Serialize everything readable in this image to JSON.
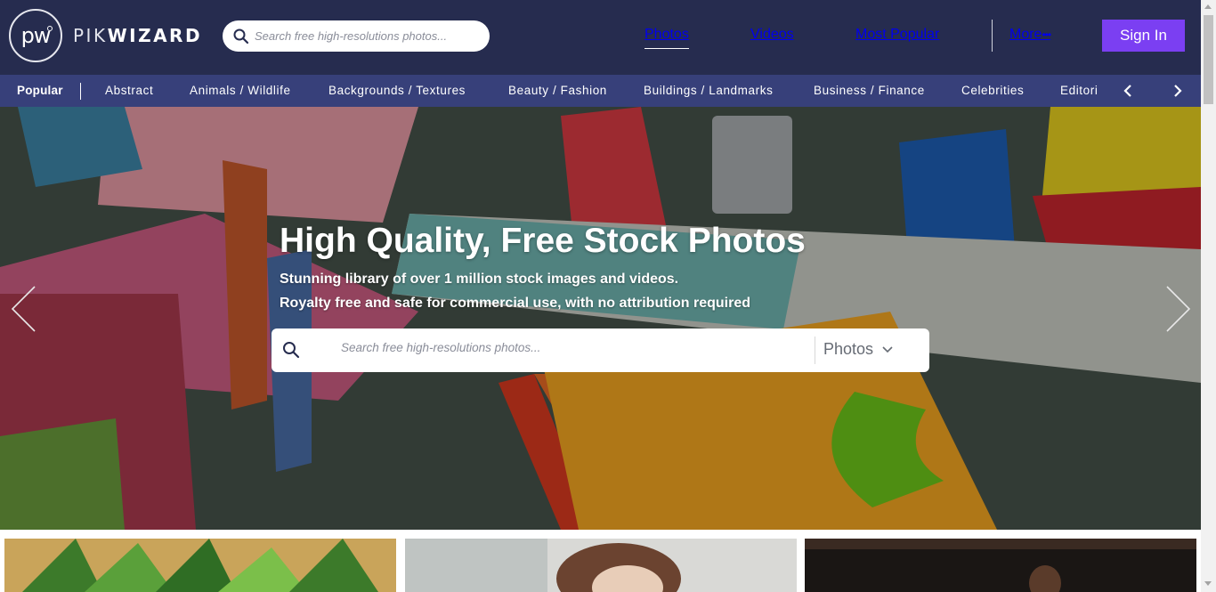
{
  "logo": {
    "mark": "pw",
    "word_light": "PIK",
    "word_bold": "WIZARD"
  },
  "header": {
    "search_placeholder": "Search free high-resolutions photos...",
    "nav": {
      "photos": "Photos",
      "videos": "Videos",
      "most_popular": "Most Popular",
      "more": "More",
      "more_dots": "•••"
    },
    "signin": "Sign In"
  },
  "categories": {
    "active": "Popular",
    "items": [
      "Abstract",
      "Animals / Wildlife",
      "Backgrounds / Textures",
      "Beauty / Fashion",
      "Buildings / Landmarks",
      "Business / Finance",
      "Celebrities"
    ],
    "clipped": "Editorial"
  },
  "hero": {
    "title": "High Quality, Free Stock Photos",
    "sub1": "Stunning library of over 1 million stock images and videos.",
    "sub2": "Royalty free and safe for commercial use, with no attribution required",
    "search_placeholder": "Search free high-resolutions photos...",
    "search_type": "Photos"
  },
  "colors": {
    "header_bg": "#262c4f",
    "catbar_bg": "#37407a",
    "signin_bg": "#7b3ff2"
  }
}
